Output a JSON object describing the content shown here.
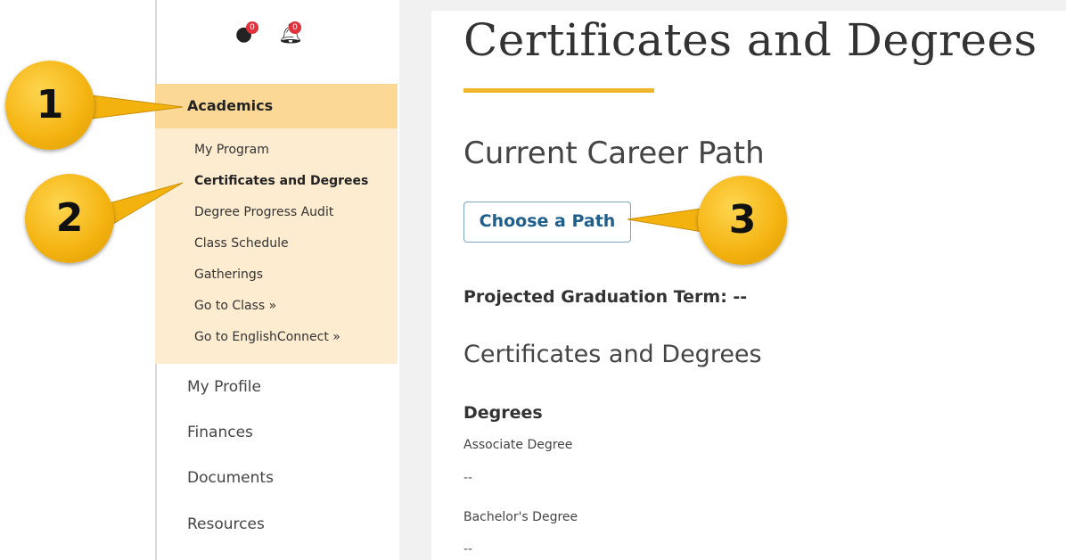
{
  "notifications": {
    "alerts_count": "0",
    "bell_count": "0"
  },
  "sidebar": {
    "section": "Academics",
    "sub_items": [
      "My Program",
      "Certificates and Degrees",
      "Degree Progress Audit",
      "Class Schedule",
      "Gatherings",
      "Go to Class »",
      "Go to EnglishConnect »"
    ],
    "items": [
      "My Profile",
      "Finances",
      "Documents",
      "Resources"
    ]
  },
  "main": {
    "title": "Certificates and Degrees",
    "current_path_title": "Current Career Path",
    "choose_path_button": "Choose a Path",
    "projected_graduation": "Projected Graduation Term: --",
    "section_title": "Certificates and Degrees",
    "degrees_heading": "Degrees",
    "degrees": [
      {
        "label": "Associate Degree",
        "value": "--"
      },
      {
        "label": "Bachelor's Degree",
        "value": "--"
      }
    ]
  },
  "callouts": [
    "1",
    "2",
    "3"
  ],
  "colors": {
    "highlight": "#fcd896",
    "submenu": "#fdecd0",
    "accent_rule": "#f0b62b",
    "callout": "#f4b20f",
    "button_text": "#1f5f8b"
  }
}
